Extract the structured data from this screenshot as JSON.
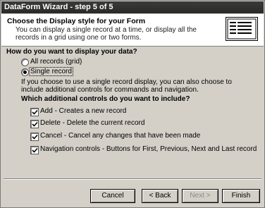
{
  "window": {
    "title": "DataForm Wizard - step 5 of 5"
  },
  "header": {
    "title": "Choose the Display style for your Form",
    "description": "You can display a single record at a time, or display all the records in a grid using one or two forms.",
    "icon": "form-layout-icon"
  },
  "question": "How do you want to display your data?",
  "radios": [
    {
      "label": "All records (grid)",
      "selected": false
    },
    {
      "label": "Single record",
      "selected": true
    }
  ],
  "info_text": "If you choose to use a single record display, you can also choose to include additional controls for commands and navigation.",
  "controls_question": "Which additional controls do you want to include?",
  "checkboxes": [
    {
      "label": "Add - Creates  a new record",
      "checked": true
    },
    {
      "label": "Delete - Delete the current record",
      "checked": true
    },
    {
      "label": "Cancel - Cancel any changes that have been made",
      "checked": true
    },
    {
      "label": "Navigation controls - Buttons for First, Previous, Next and Last record",
      "checked": true
    }
  ],
  "buttons": {
    "cancel": "Cancel",
    "back": "< Back",
    "next": "Next >",
    "finish": "Finish"
  }
}
